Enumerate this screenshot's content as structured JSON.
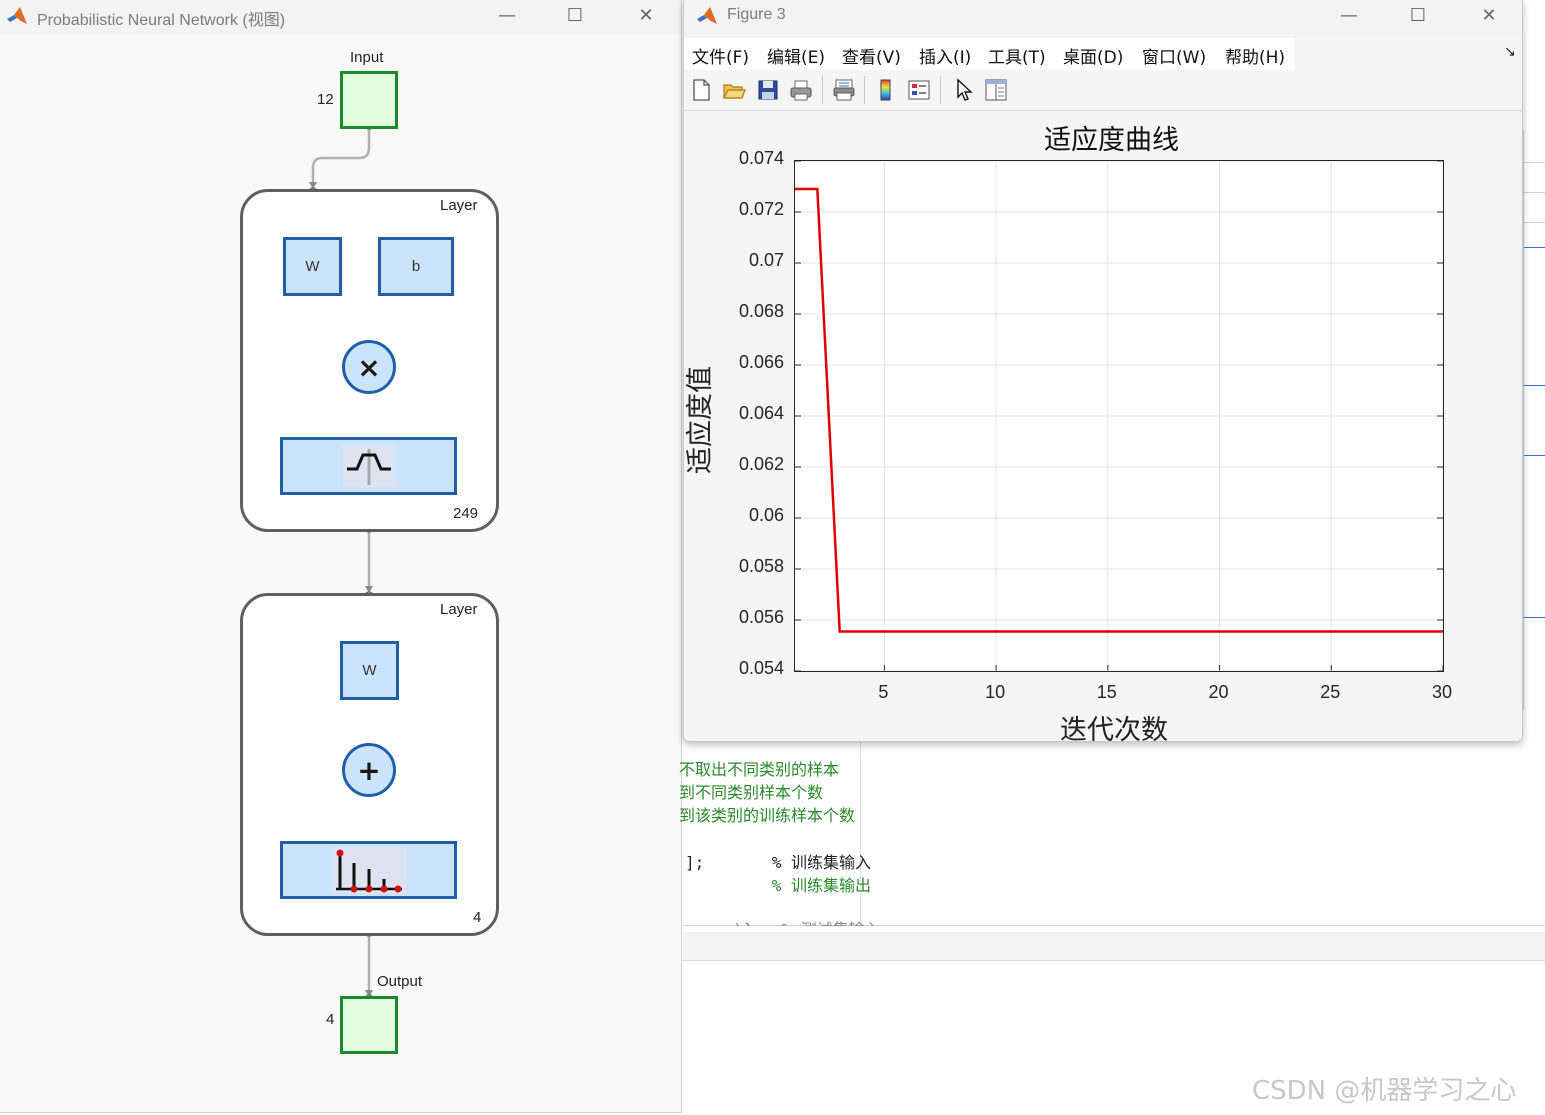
{
  "pnn_window": {
    "title": "Probabilistic Neural Network (视图)",
    "input_label": "Input",
    "input_size": "12",
    "layer1": {
      "label": "Layer",
      "weight": "W",
      "bias": "b",
      "size": "249"
    },
    "layer2": {
      "label": "Layer",
      "weight": "W",
      "size": "4"
    },
    "output_label": "Output",
    "output_size": "4"
  },
  "figure_window": {
    "title": "Figure 3",
    "menu": [
      "文件(F)",
      "编辑(E)",
      "查看(V)",
      "插入(I)",
      "工具(T)",
      "桌面(D)",
      "窗口(W)",
      "帮助(H)"
    ],
    "toolbar_icons": [
      "new-figure-icon",
      "open-icon",
      "save-icon",
      "print-icon",
      "print-preview-icon",
      "colorbar-icon",
      "legend-icon",
      "pointer-icon",
      "property-editor-icon"
    ]
  },
  "chart_data": {
    "type": "line",
    "title": "适应度曲线",
    "xlabel": "迭代次数",
    "ylabel": "适应度值",
    "xlim": [
      1,
      30
    ],
    "ylim": [
      0.054,
      0.074
    ],
    "xticks": [
      "5",
      "10",
      "15",
      "20",
      "25",
      "30"
    ],
    "xtick_values": [
      5,
      10,
      15,
      20,
      25,
      30
    ],
    "yticks": [
      "0.074",
      "0.072",
      "0.07",
      "0.068",
      "0.066",
      "0.064",
      "0.062",
      "0.06",
      "0.058",
      "0.056",
      "0.054"
    ],
    "ytick_values": [
      0.074,
      0.072,
      0.07,
      0.068,
      0.066,
      0.064,
      0.062,
      0.06,
      0.058,
      0.056,
      0.054
    ],
    "grid": true,
    "series": [
      {
        "color": "#e00000",
        "x": [
          1,
          2,
          3,
          4,
          5,
          6,
          7,
          8,
          9,
          10,
          11,
          12,
          13,
          14,
          15,
          16,
          17,
          18,
          19,
          20,
          21,
          22,
          23,
          24,
          25,
          26,
          27,
          28,
          29,
          30
        ],
        "y": [
          0.0729,
          0.0729,
          0.05555,
          0.05555,
          0.05555,
          0.05555,
          0.05555,
          0.05555,
          0.05555,
          0.05555,
          0.05555,
          0.05555,
          0.05555,
          0.05555,
          0.05555,
          0.05555,
          0.05555,
          0.05555,
          0.05555,
          0.05555,
          0.05555,
          0.05555,
          0.05555,
          0.05555,
          0.05555,
          0.05555,
          0.05555,
          0.05555,
          0.05555,
          0.05555
        ]
      }
    ]
  },
  "editor": {
    "lines": [
      "不取出不同类别的样本",
      "到不同类别样本个数",
      "到该类别的训练样本个数",
      "",
      "];       % 训练集输入",
      "         % 训练集输出",
      "",
      "  ..:)]   % 测试集输入"
    ]
  },
  "watermark": "CSDN @机器学习之心"
}
